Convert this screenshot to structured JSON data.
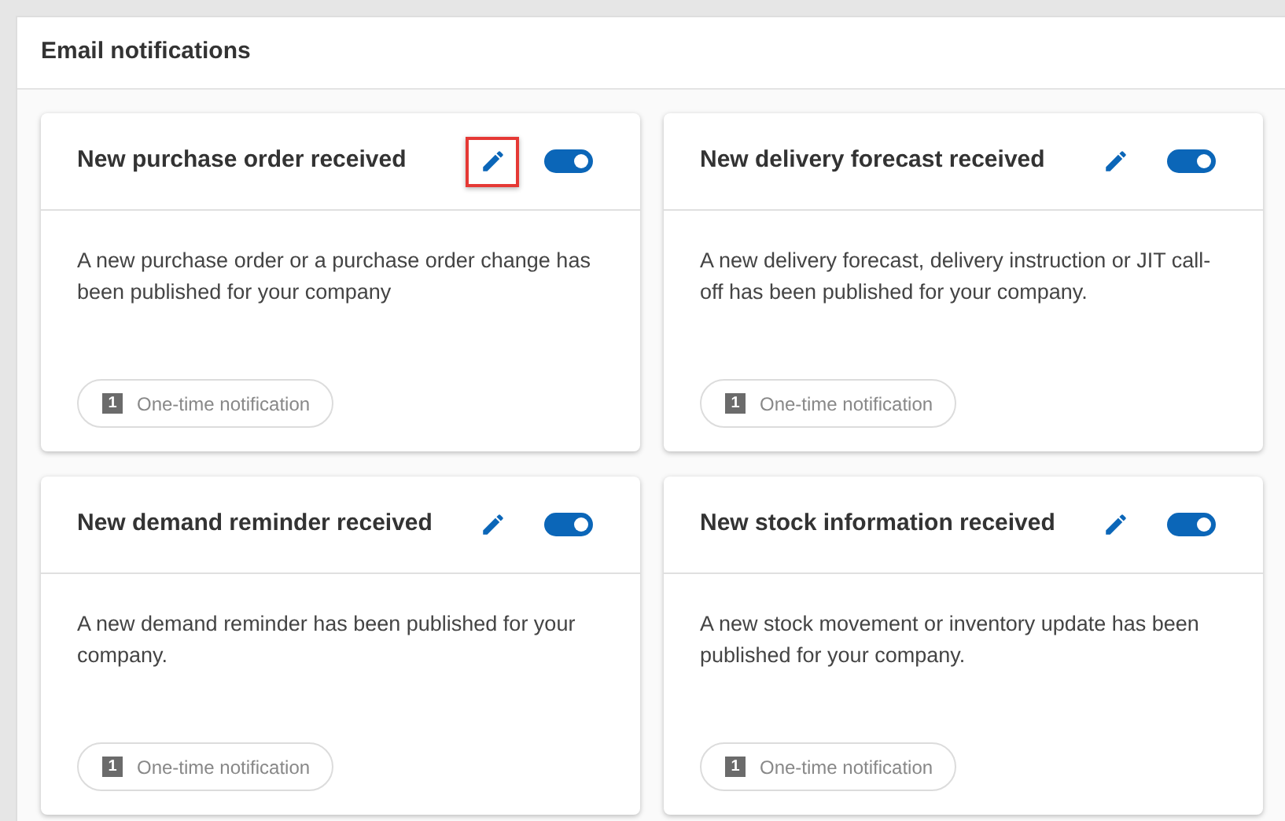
{
  "panel": {
    "title": "Email notifications"
  },
  "cards": [
    {
      "title": "New purchase order received",
      "edit_highlighted": true,
      "on": true,
      "description": "A new purchase order or a purchase order change has been published for your company",
      "chip": {
        "badge": "1",
        "label": "One-time notification"
      }
    },
    {
      "title": "New delivery forecast received",
      "edit_highlighted": false,
      "on": true,
      "description": "A new delivery forecast, delivery instruction or JIT call-off has been published for your company.",
      "chip": {
        "badge": "1",
        "label": "One-time notification"
      }
    },
    {
      "title": "New demand reminder received",
      "edit_highlighted": false,
      "on": true,
      "description": "A new demand reminder has been published for your company.",
      "chip": {
        "badge": "1",
        "label": "One-time notification"
      }
    },
    {
      "title": "New stock information received",
      "edit_highlighted": false,
      "on": true,
      "description": "A new stock movement or inventory update has been published for your company.",
      "chip": {
        "badge": "1",
        "label": "One-time notification"
      }
    }
  ]
}
